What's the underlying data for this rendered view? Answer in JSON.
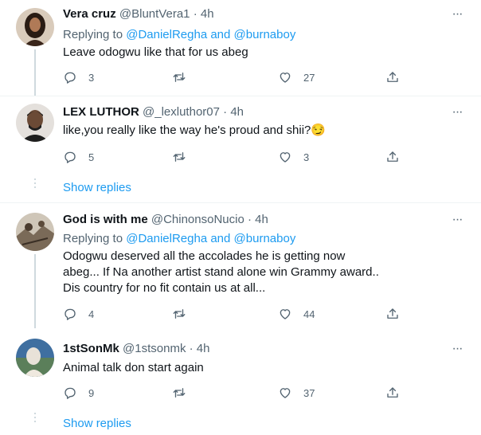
{
  "tweets": [
    {
      "name": "Vera cruz",
      "handle": "@BluntVera1",
      "sep": "·",
      "time": "4h",
      "replying_prefix": "Replying to",
      "replying_user1": "@DanielRegha",
      "replying_and": "and",
      "replying_user2": "@burnaboy",
      "text": "Leave odogwu like that for us abeg",
      "replies": "3",
      "retweets": "",
      "likes": "27"
    },
    {
      "name": "LEX LUTHOR",
      "handle": "@_lexluthor07",
      "sep": "·",
      "time": "4h",
      "text": "like,you really like the way he's proud and shii?😏",
      "replies": "5",
      "retweets": "",
      "likes": "3"
    },
    {
      "name": "God is with me",
      "handle": "@ChinonsoNucio",
      "sep": "·",
      "time": "4h",
      "replying_prefix": "Replying to",
      "replying_user1": "@DanielRegha",
      "replying_and": "and",
      "replying_user2": "@burnaboy",
      "text": "Odogwu deserved all the accolades he is getting now abeg... If Na another artist stand alone win Grammy award.. Dis country for no fit contain us at all...",
      "replies": "4",
      "retweets": "",
      "likes": "44"
    },
    {
      "name": "1stSonMk",
      "handle": "@1stsonmk",
      "sep": "·",
      "time": "4h",
      "text": "Animal talk don start again",
      "replies": "9",
      "retweets": "",
      "likes": "37"
    }
  ],
  "show_replies_1": "Show replies",
  "show_replies_2": "Show replies",
  "colors": {
    "link": "#1d9bf0",
    "secondary": "#536471",
    "divider": "#eff3f4",
    "thread": "#cfd9de"
  }
}
